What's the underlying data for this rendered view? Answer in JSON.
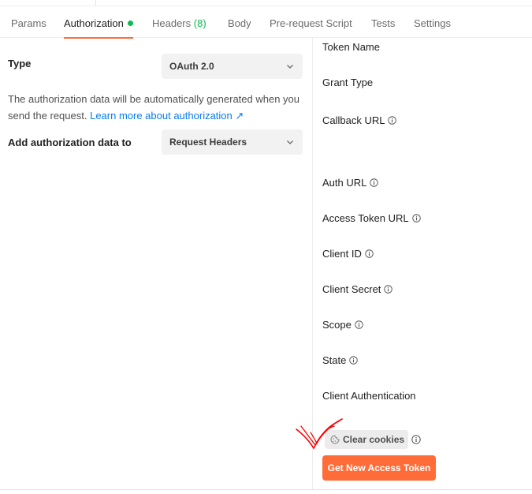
{
  "tabs": [
    {
      "label": "Params"
    },
    {
      "label": "Authorization"
    },
    {
      "label": "Headers",
      "count": "(8)"
    },
    {
      "label": "Body"
    },
    {
      "label": "Pre-request Script"
    },
    {
      "label": "Tests"
    },
    {
      "label": "Settings"
    }
  ],
  "active_tab": "Authorization",
  "left": {
    "type_label": "Type",
    "type_value": "OAuth 2.0",
    "description": "The authorization data will be automatically generated when you send the request.",
    "learn_more": "Learn more about authorization",
    "learn_more_arrow": "↗",
    "add_to_label": "Add authorization data to",
    "add_to_value": "Request Headers"
  },
  "right": {
    "fields": [
      {
        "label": "Token Name"
      },
      {
        "label": "Grant Type"
      },
      {
        "label": "Callback URL"
      },
      {
        "label": "Auth URL"
      },
      {
        "label": "Access Token URL"
      },
      {
        "label": "Client ID"
      },
      {
        "label": "Client Secret"
      },
      {
        "label": "Scope"
      },
      {
        "label": "State"
      },
      {
        "label": "Client Authentication"
      }
    ],
    "clear_cookies": "Clear cookies",
    "get_token": "Get New Access Token"
  },
  "colors": {
    "accent": "#ff6c37",
    "status_green": "#0cbb52",
    "link": "#097bed",
    "annotation": "#ff0000"
  },
  "icons": [
    "info-icon",
    "chevron-down-icon",
    "cookie-icon",
    "external-link-arrow-icon",
    "handwritten-checkmark"
  ]
}
